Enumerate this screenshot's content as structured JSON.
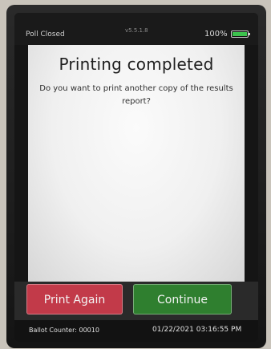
{
  "status_bar": {
    "poll_status": "Poll Closed",
    "version": "v5.5.1.8",
    "battery_percent": "100%",
    "battery_level": 1.0
  },
  "dialog": {
    "title": "Printing completed",
    "message": "Do you want to print another copy of the results report?"
  },
  "buttons": {
    "print_again": "Print Again",
    "continue": "Continue"
  },
  "footer": {
    "ballot_counter": "Ballot Counter: 00010",
    "datetime": "01/22/2021 03:16:55 PM"
  },
  "colors": {
    "print_again_button": "#c23a49",
    "continue_button": "#2f7f2f",
    "battery_fill": "#3cc24d"
  }
}
